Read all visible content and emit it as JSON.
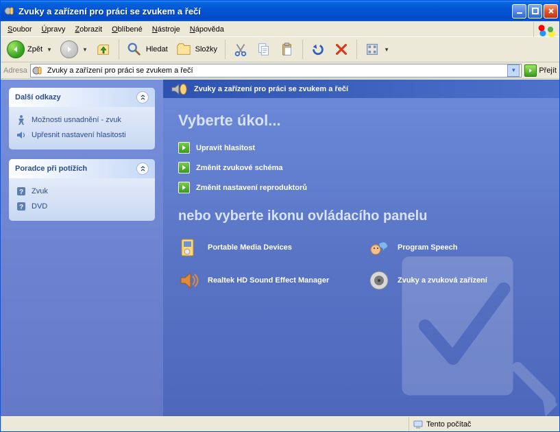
{
  "titlebar": {
    "title": "Zvuky a zařízení pro práci se zvukem a řečí"
  },
  "menu": {
    "items": [
      {
        "prefix": "S",
        "rest": "oubor"
      },
      {
        "prefix": "Ú",
        "rest": "pravy"
      },
      {
        "prefix": "Z",
        "rest": "obrazit"
      },
      {
        "prefix": "O",
        "rest": "blíbené"
      },
      {
        "prefix": "N",
        "rest": "ástroje"
      },
      {
        "prefix": "N",
        "rest": "ápověda"
      }
    ]
  },
  "toolbar": {
    "back": "Zpět",
    "search": "Hledat",
    "folders": "Složky"
  },
  "addressbar": {
    "label": "Adresa",
    "value": "Zvuky a zařízení pro práci se zvukem a řečí",
    "go": "Přejít"
  },
  "sidebar": {
    "panels": [
      {
        "title": "Další odkazy",
        "links": [
          {
            "icon": "accessibility",
            "label": "Možnosti usnadnění - zvuk"
          },
          {
            "icon": "volume",
            "label": "Upřesnit nastavení hlasitosti"
          }
        ]
      },
      {
        "title": "Poradce při potížích",
        "links": [
          {
            "icon": "help",
            "label": "Zvuk"
          },
          {
            "icon": "help",
            "label": "DVD"
          }
        ]
      }
    ]
  },
  "content": {
    "header": "Zvuky a zařízení pro práci se zvukem a řečí",
    "heading1": "Vyberte úkol...",
    "tasks": [
      "Upravit hlasitost",
      "Změnit zvukové schéma",
      "Změnit nastavení reproduktorů"
    ],
    "heading2": "nebo vyberte ikonu ovládacího panelu",
    "items": [
      {
        "icon": "pmd",
        "label": "Portable Media Devices"
      },
      {
        "icon": "speech",
        "label": "Program Speech"
      },
      {
        "icon": "realtek",
        "label": "Realtek HD Sound Effect Manager"
      },
      {
        "icon": "sound",
        "label": "Zvuky a zvuková zařízení"
      }
    ]
  },
  "statusbar": {
    "location": "Tento počítač"
  }
}
